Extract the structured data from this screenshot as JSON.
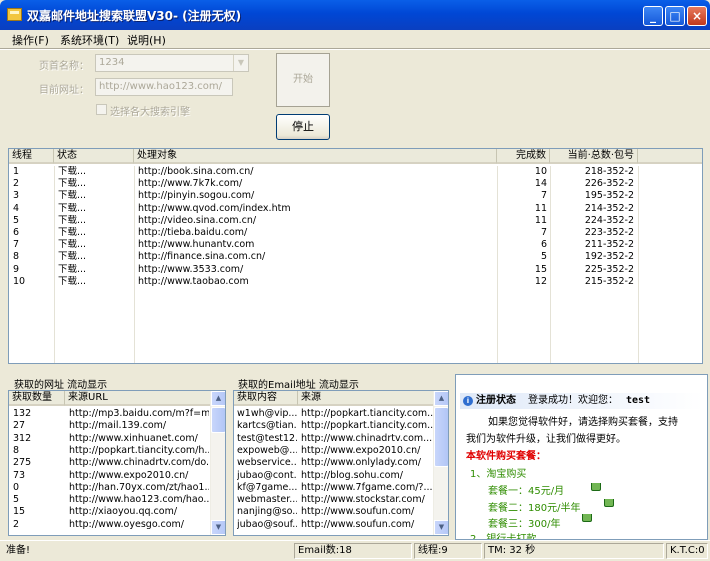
{
  "window": {
    "title": "双嘉邮件地址搜索联盟V30- (注册无权)",
    "minimize": "_",
    "maximize": "□",
    "close": "×"
  },
  "menu": [
    "操作(F)",
    "系统环境(T)",
    "说明(H)"
  ],
  "form": {
    "start_label": "页首名称：",
    "start_value": "1234",
    "url_label": "目前网址：",
    "url_value": "http://www.hao123.com/",
    "checkbox_label": "选择各大搜索引擎",
    "start_button": "开始",
    "stop_button": "停止"
  },
  "threads": {
    "columns": [
      "线程",
      "状态",
      "处理对象",
      "完成数",
      "当前·总数·包号"
    ],
    "rows": [
      [
        "1",
        "下载...",
        "http://book.sina.com.cn/",
        "10",
        "218-352-2"
      ],
      [
        "2",
        "下载...",
        "http://www.7k7k.com/",
        "14",
        "226-352-2"
      ],
      [
        "3",
        "下载...",
        "http://pinyin.sogou.com/",
        "7",
        "195-352-2"
      ],
      [
        "4",
        "下载...",
        "http://www.qvod.com/index.htm",
        "11",
        "214-352-2"
      ],
      [
        "5",
        "下载...",
        "http://video.sina.com.cn/",
        "11",
        "224-352-2"
      ],
      [
        "6",
        "下载...",
        "http://tieba.baidu.com/",
        "7",
        "223-352-2"
      ],
      [
        "7",
        "下载...",
        "http://www.hunantv.com",
        "6",
        "211-352-2"
      ],
      [
        "8",
        "下载...",
        "http://finance.sina.com.cn/",
        "5",
        "192-352-2"
      ],
      [
        "9",
        "下载...",
        "http://www.3533.com/",
        "15",
        "225-352-2"
      ],
      [
        "10",
        "下载...",
        "http://www.taobao.com",
        "12",
        "215-352-2"
      ]
    ]
  },
  "urls_panel": {
    "title": "获取的网址    流动显示",
    "columns": [
      "获取数量",
      "来源URL"
    ],
    "rows": [
      [
        "132",
        "http://mp3.baidu.com/m?f=m..."
      ],
      [
        "27",
        "http://mail.139.com/"
      ],
      [
        "312",
        "http://www.xinhuanet.com/"
      ],
      [
        "8",
        "http://popkart.tiancity.com/h..."
      ],
      [
        "275",
        "http://www.chinadrtv.com/do..."
      ],
      [
        "73",
        "http://www.expo2010.cn/"
      ],
      [
        "0",
        "http://han.70yx.com/zt/hao1..."
      ],
      [
        "5",
        "http://www.hao123.com/hao..."
      ],
      [
        "15",
        "http://xiaoyou.qq.com/"
      ],
      [
        "2",
        "http://www.oyesgo.com/"
      ]
    ]
  },
  "email_panel": {
    "title": "获取的Email地址    流动显示",
    "columns": [
      "获取内容",
      "来源"
    ],
    "rows": [
      [
        "w1wh@vip....",
        "http://popkart.tiancity.com..."
      ],
      [
        "kartcs@tian...",
        "http://popkart.tiancity.com..."
      ],
      [
        "test@test12...",
        "http://www.chinadrtv.com..."
      ],
      [
        "expoweb@...",
        "http://www.expo2010.cn/"
      ],
      [
        "webservice...",
        "http://www.onlylady.com/"
      ],
      [
        "jubao@cont...",
        "http://blog.sohu.com/"
      ],
      [
        "kf@7game....",
        "http://www.7fgame.com/?..."
      ],
      [
        "webmaster...",
        "http://www.stockstar.com/"
      ],
      [
        "nanjing@so...",
        "http://www.soufun.com/"
      ],
      [
        "jubao@souf...",
        "http://www.soufun.com/"
      ]
    ]
  },
  "info": {
    "status_label": "注册状态",
    "status_text": "登录成功！欢迎您：",
    "user": "test",
    "line1": "如果您觉得软件好，请选择购买套餐，支持",
    "line2": "我们为软件升级，让我们做得更好。",
    "pkg_title": "本软件购买套餐：",
    "item1": "1、淘宝购买",
    "pkg1": "套餐一：45元/月",
    "pkg2": "套餐二：180元/半年",
    "pkg3": "套餐三：300/年",
    "item2": "2、银行卡打款"
  },
  "statusbar": {
    "ready": "准备!",
    "email_count": "Email数:18",
    "threads": "线程:9",
    "time": "TM: 32 秒",
    "ktc": "K.T.C:0"
  }
}
